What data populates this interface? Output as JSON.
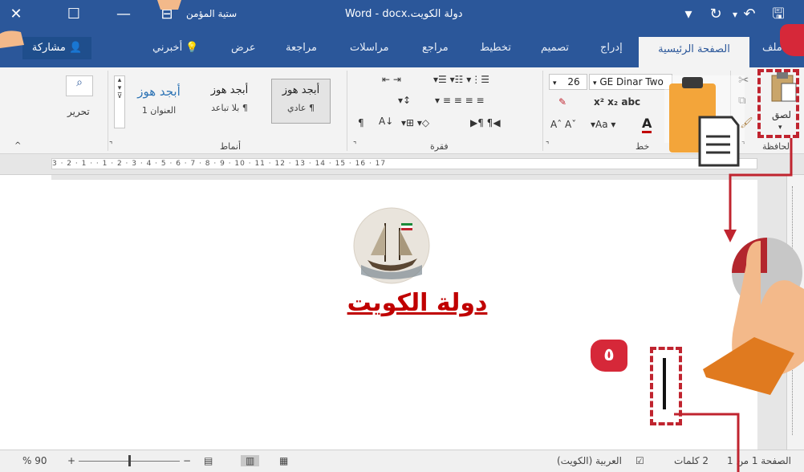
{
  "titlebar": {
    "doc_title": "Word - docx.دولة الكويت",
    "user": "ستية المؤمن",
    "colors": {
      "bar": "#2b579a"
    }
  },
  "tabs": {
    "file": "ملف",
    "home": "الصفحة الرئيسية",
    "insert": "إدراج",
    "design": "تصميم",
    "layout": "تخطيط",
    "references": "مراجع",
    "mailings": "مراسلات",
    "review": "مراجعة",
    "view": "عرض",
    "tell_me": "أخبرني",
    "share": "مشاركة"
  },
  "ribbon": {
    "paste": "لصق",
    "clipboard": "الحافظة",
    "font_name": "GE Dinar Two",
    "font_size": "26",
    "font_group": "خط",
    "paragraph_group": "فقرة",
    "styles_group": "أنماط",
    "editing": "تحرير",
    "styles": [
      {
        "preview": "أبجد هوز",
        "name": "¶ عادي"
      },
      {
        "preview": "أبجد هوز",
        "name": "¶ بلا تباعد"
      },
      {
        "preview": "أبجد هوز",
        "name": "العنوان 1"
      }
    ],
    "aa_label": "Aa"
  },
  "ruler": {
    "ticks": "3 · 2 · 1 · · 1 · 2 · 3 · 4 · 5 · 6 · 7 · 8 · 9 · 10 · 11 · 12 · 13 · 14 · 15 · 16 · 17"
  },
  "document": {
    "title": "دولة الكويت"
  },
  "overlay": {
    "step_number": "٥",
    "accent": "#d62839"
  },
  "statusbar": {
    "page": "الصفحة 1 من 1",
    "words": "2 كلمات",
    "language": "العربية (الكويت)",
    "zoom": "90 %",
    "zoom_level": 90
  }
}
